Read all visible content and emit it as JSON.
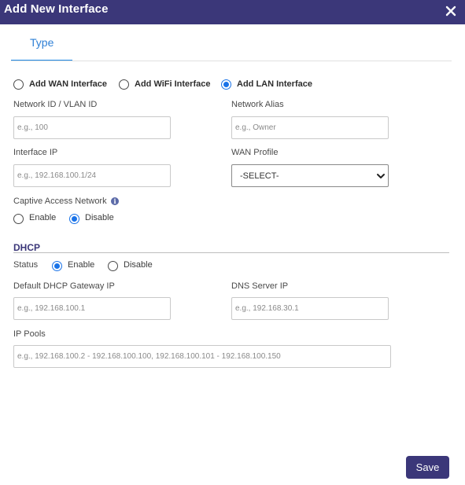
{
  "header": {
    "title": "Add New Interface",
    "close_icon": "close-icon"
  },
  "tabs": [
    {
      "label": "Type",
      "active": true
    }
  ],
  "interface_type": {
    "options": [
      "Add WAN Interface",
      "Add WiFi Interface",
      "Add LAN Interface"
    ],
    "selected": "Add LAN Interface"
  },
  "fields": {
    "network_id": {
      "label": "Network ID / VLAN ID",
      "placeholder": "e.g., 100",
      "value": ""
    },
    "network_alias": {
      "label": "Network Alias",
      "placeholder": "e.g., Owner",
      "value": ""
    },
    "interface_ip": {
      "label": "Interface IP",
      "placeholder": "e.g., 192.168.100.1/24",
      "value": ""
    },
    "wan_profile": {
      "label": "WAN Profile",
      "selected": "-SELECT-"
    }
  },
  "captive": {
    "label": "Captive Access Network",
    "info_icon": "info-icon",
    "options": [
      "Enable",
      "Disable"
    ],
    "selected": "Disable"
  },
  "dhcp": {
    "title": "DHCP",
    "status_label": "Status",
    "options": [
      "Enable",
      "Disable"
    ],
    "selected": "Enable",
    "gateway": {
      "label": "Default DHCP Gateway IP",
      "placeholder": "e.g., 192.168.100.1",
      "value": ""
    },
    "dns": {
      "label": "DNS Server IP",
      "placeholder": "e.g., 192.168.30.1",
      "value": ""
    },
    "pools": {
      "label": "IP Pools",
      "placeholder": "e.g., 192.168.100.2 - 192.168.100.100, 192.168.100.101 - 192.168.100.150",
      "value": ""
    }
  },
  "footer": {
    "save_label": "Save"
  },
  "colors": {
    "header": "#3b3779",
    "accent": "#1a73e8",
    "tab_text": "#2f80d6",
    "save_button": "#3b3779"
  }
}
